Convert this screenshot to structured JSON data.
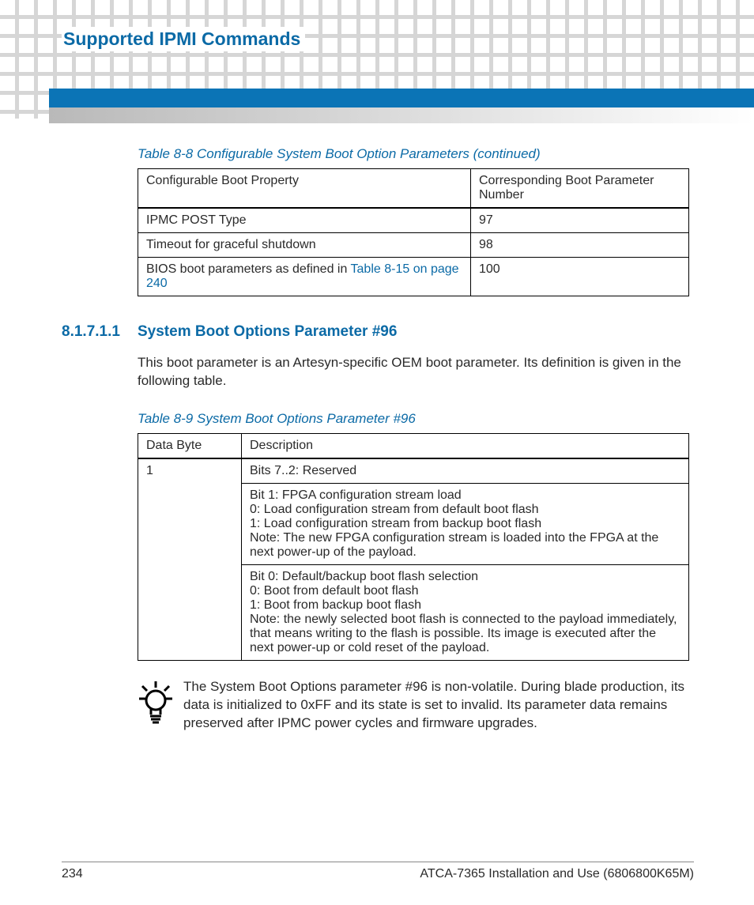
{
  "header": {
    "title": "Supported IPMI Commands"
  },
  "table8_8": {
    "caption": "Table 8-8 Configurable System Boot Option Parameters (continued)",
    "headers": [
      "Configurable Boot Property",
      "Corresponding Boot Parameter Number"
    ],
    "rows": [
      {
        "property": "IPMC POST Type",
        "number": "97"
      },
      {
        "property_prefix": "BIOS boot parameters as defined in ",
        "property_link": "Table 8-15 on page 240",
        "number": "100",
        "is_link_row": true
      },
      {
        "property": "Timeout for graceful shutdown",
        "number": "98"
      }
    ],
    "row0": {
      "property": "IPMC POST Type",
      "number": "97"
    },
    "row1": {
      "property": "Timeout for graceful shutdown",
      "number": "98"
    },
    "row2": {
      "property_prefix": "BIOS boot parameters as defined in ",
      "property_link": "Table 8-15 on page 240",
      "number": "100"
    }
  },
  "section": {
    "number": "8.1.7.1.1",
    "title": "System Boot Options Parameter #96",
    "intro": "This boot parameter is an Artesyn-specific OEM boot parameter. Its definition is given in the following table."
  },
  "table8_9": {
    "caption": "Table 8-9 System Boot Options Parameter #96",
    "headers": [
      "Data Byte",
      "Description"
    ],
    "data_byte": "1",
    "cell1": "Bits 7..2: Reserved",
    "cell2_l1": "Bit 1: FPGA configuration stream load",
    "cell2_l2": "0: Load configuration stream from default boot flash",
    "cell2_l3": "1: Load configuration stream from backup boot flash",
    "cell2_l4": "Note: The new FPGA configuration stream is loaded into the FPGA at the next power-up of the payload.",
    "cell3_l1": "Bit 0: Default/backup boot flash selection",
    "cell3_l2": "0: Boot from default boot flash",
    "cell3_l3": "1: Boot from backup boot flash",
    "cell3_l4": "Note: the newly selected boot flash is connected to the payload immediately, that means writing to the flash is possible. Its image is executed after the next power-up or cold reset of the payload."
  },
  "tip": {
    "text": "The System Boot Options parameter #96 is non-volatile. During blade production, its data is initialized to 0xFF and its state is set to invalid. Its parameter data remains preserved after IPMC power cycles and firmware upgrades."
  },
  "footer": {
    "page": "234",
    "doc": "ATCA-7365 Installation and Use (6806800K65M)"
  }
}
